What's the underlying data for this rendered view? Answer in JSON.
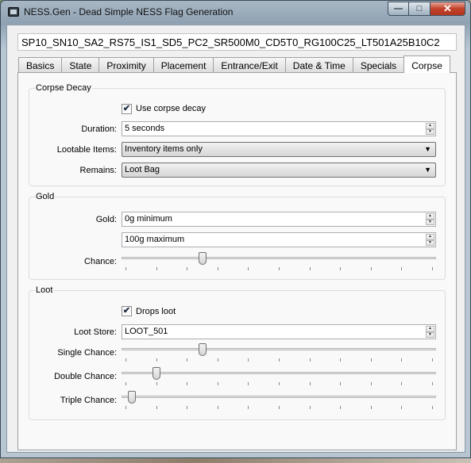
{
  "window": {
    "title": "NESS.Gen - Dead Simple NESS Flag Generation",
    "controls": {
      "minimize": "—",
      "maximize": "□",
      "close": "✕"
    }
  },
  "flag_string": "SP10_SN10_SA2_RS75_IS1_SD5_PC2_SR500M0_CD5T0_RG100C25_LT501A25B10C2",
  "tabs": [
    "Basics",
    "State",
    "Proximity",
    "Placement",
    "Entrance/Exit",
    "Date & Time",
    "Specials",
    "Corpse"
  ],
  "active_tab": "Corpse",
  "corpse_decay": {
    "title": "Corpse Decay",
    "use_label": "Use corpse decay",
    "use_checked": true,
    "duration_label": "Duration:",
    "duration_value": "5 seconds",
    "lootable_label": "Lootable Items:",
    "lootable_value": "Inventory items only",
    "remains_label": "Remains:",
    "remains_value": "Loot Bag"
  },
  "gold": {
    "title": "Gold",
    "gold_label": "Gold:",
    "min_value": "0g minimum",
    "max_value": "100g maximum",
    "chance_label": "Chance:",
    "chance_level": 0.25
  },
  "loot": {
    "title": "Loot",
    "drops_label": "Drops loot",
    "drops_checked": true,
    "store_label": "Loot Store:",
    "store_value": "LOOT_501",
    "single_label": "Single Chance:",
    "single_level": 0.25,
    "double_label": "Double Chance:",
    "double_level": 0.1,
    "triple_label": "Triple Chance:",
    "triple_level": 0.02
  },
  "icons": {
    "check": "✔",
    "spin_up": "▲",
    "spin_down": "▼",
    "dropdown": "▼"
  }
}
